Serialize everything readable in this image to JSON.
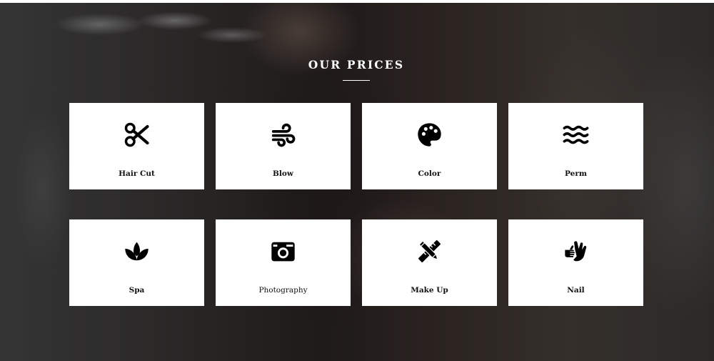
{
  "section": {
    "title": "OUR PRICES"
  },
  "services": [
    {
      "label": "Hair Cut",
      "icon": "scissors-icon"
    },
    {
      "label": "Blow",
      "icon": "wind-icon"
    },
    {
      "label": "Color",
      "icon": "palette-icon"
    },
    {
      "label": "Perm",
      "icon": "water-waves-icon"
    },
    {
      "label": "Spa",
      "icon": "spa-lotus-icon"
    },
    {
      "label": "Photography",
      "icon": "camera-icon"
    },
    {
      "label": "Make Up",
      "icon": "pencil-ruler-icon"
    },
    {
      "label": "Nail",
      "icon": "hands-icon"
    }
  ],
  "colors": {
    "card_background": "#ffffff",
    "text": "#111111",
    "title": "#ffffff"
  }
}
